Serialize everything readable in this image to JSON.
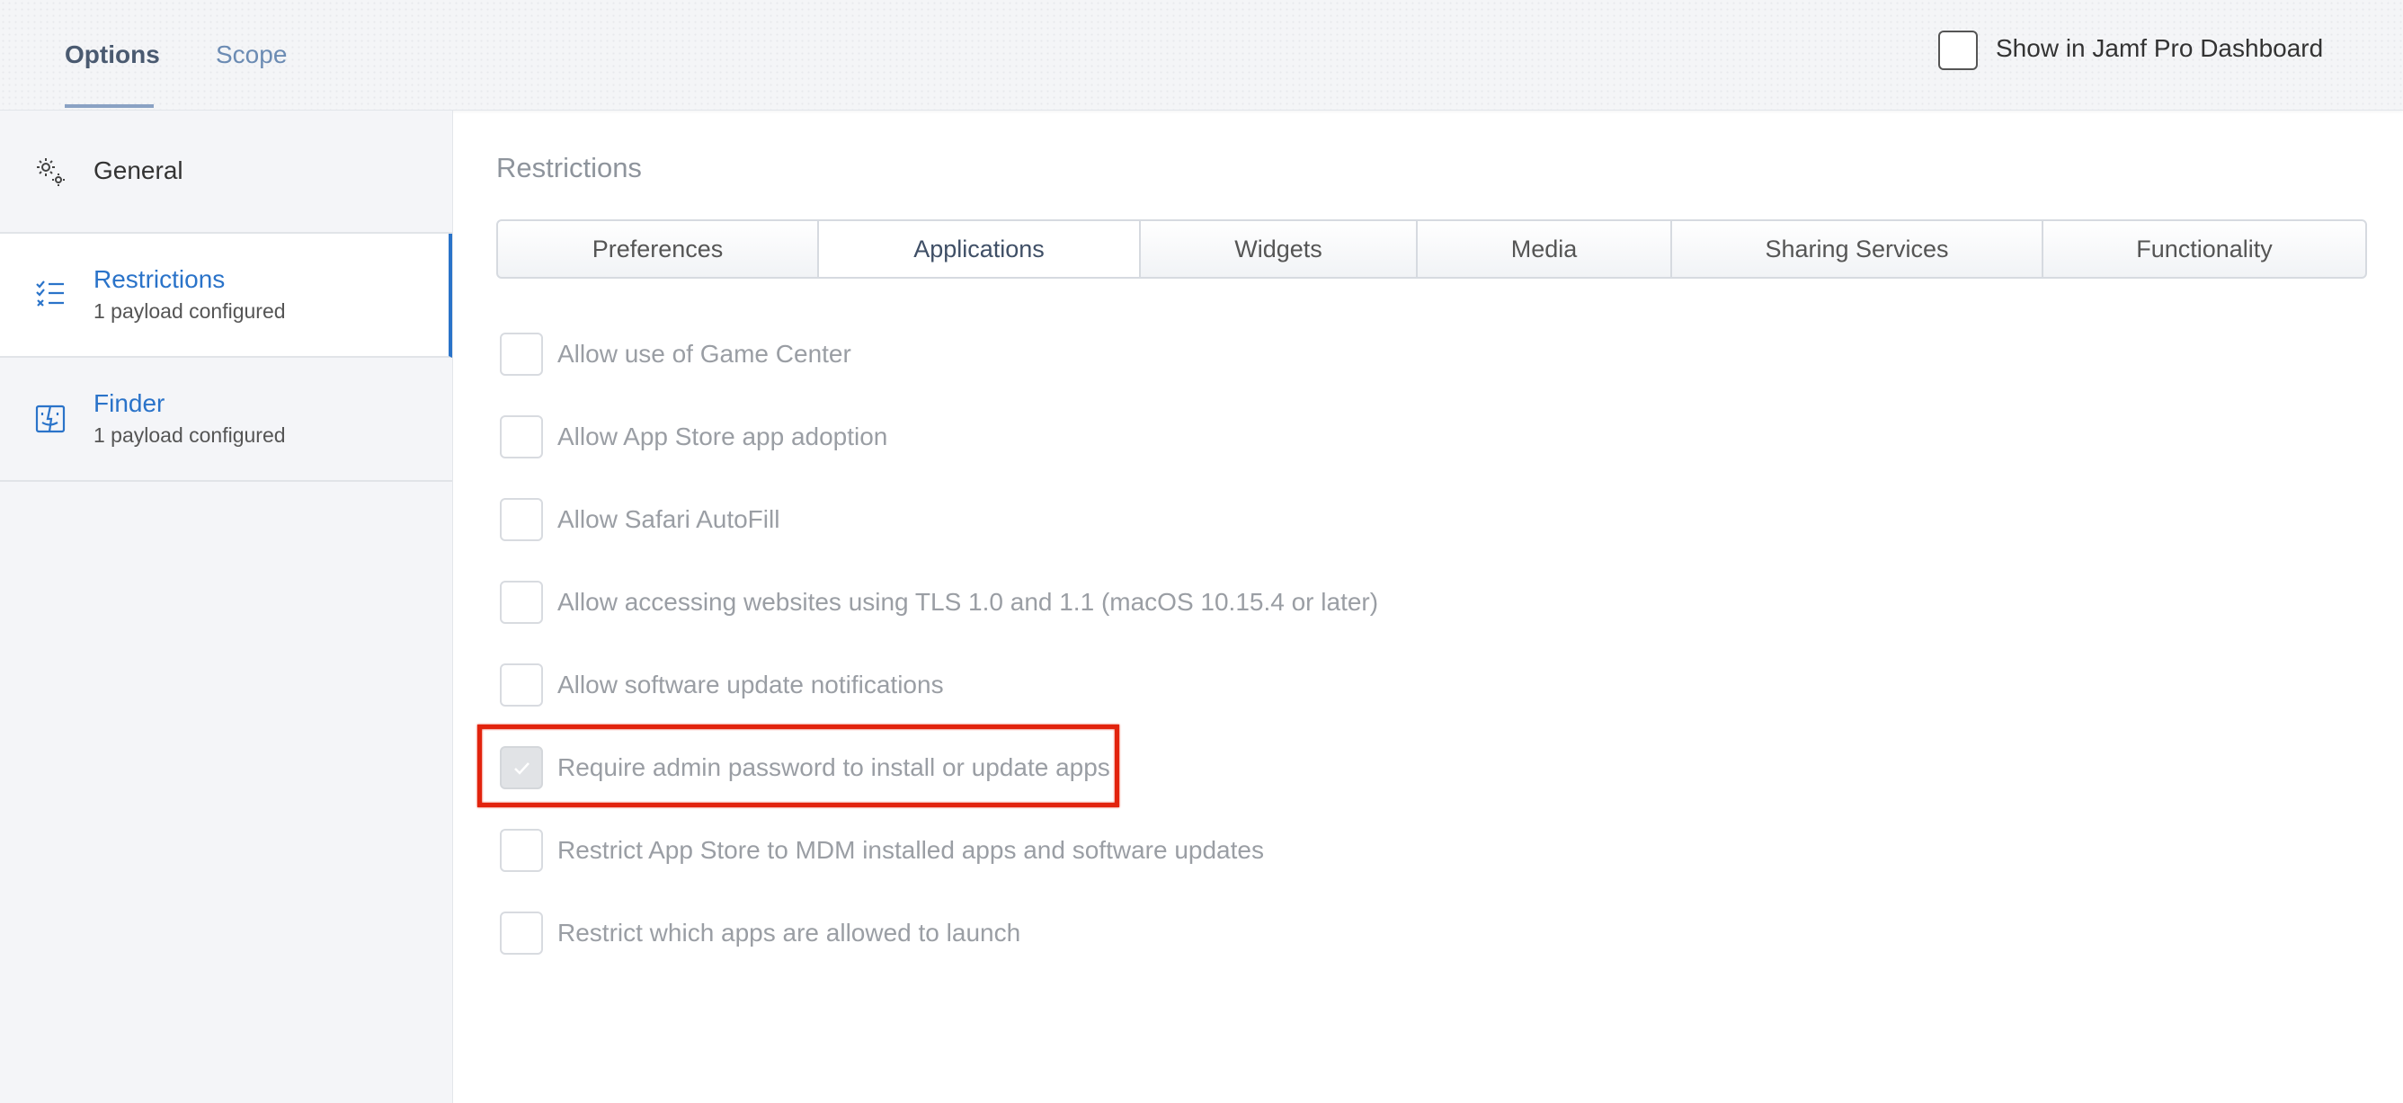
{
  "top_tabs": {
    "options": "Options",
    "scope": "Scope"
  },
  "dashboard": {
    "label": "Show in Jamf Pro Dashboard",
    "checked": false
  },
  "sidebar": {
    "items": [
      {
        "title": "General",
        "subtitle": "",
        "icon": "gear-icon"
      },
      {
        "title": "Restrictions",
        "subtitle": "1 payload configured",
        "icon": "checklist-icon",
        "selected": true
      },
      {
        "title": "Finder",
        "subtitle": "1 payload configured",
        "icon": "finder-icon"
      }
    ]
  },
  "main": {
    "section_title": "Restrictions",
    "tabs": [
      "Preferences",
      "Applications",
      "Widgets",
      "Media",
      "Sharing Services",
      "Functionality"
    ],
    "active_tab": "Applications",
    "options": [
      {
        "label": "Allow use of Game Center",
        "checked": false
      },
      {
        "label": "Allow App Store app adoption",
        "checked": false
      },
      {
        "label": "Allow Safari AutoFill",
        "checked": false
      },
      {
        "label": "Allow accessing websites using TLS 1.0 and 1.1 (macOS 10.15.4 or later)",
        "checked": false
      },
      {
        "label": "Allow software update notifications",
        "checked": false
      },
      {
        "label": "Require admin password to install or update apps",
        "checked": true
      },
      {
        "label": "Restrict App Store to MDM installed apps and software updates",
        "checked": false
      },
      {
        "label": "Restrict which apps are allowed to launch",
        "checked": false
      }
    ]
  },
  "colors": {
    "accent": "#2a73c9",
    "annotation": "#e2230d"
  }
}
